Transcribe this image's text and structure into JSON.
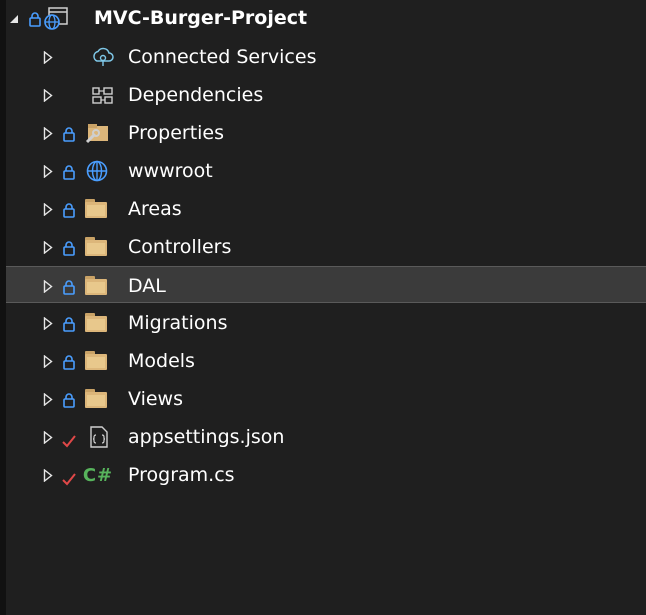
{
  "solution_explorer": {
    "project": {
      "label": "MVC-Burger-Project"
    },
    "items": [
      {
        "label": "Connected Services",
        "icon": "connected-services-icon"
      },
      {
        "label": "Dependencies",
        "icon": "dependencies-icon"
      },
      {
        "label": "Properties",
        "icon": "properties-folder-icon"
      },
      {
        "label": "wwwroot",
        "icon": "globe-icon"
      },
      {
        "label": "Areas",
        "icon": "folder-icon"
      },
      {
        "label": "Controllers",
        "icon": "folder-icon"
      },
      {
        "label": "DAL",
        "icon": "folder-icon",
        "selected": true
      },
      {
        "label": "Migrations",
        "icon": "folder-icon"
      },
      {
        "label": "Models",
        "icon": "folder-icon"
      },
      {
        "label": "Views",
        "icon": "folder-icon"
      },
      {
        "label": "appsettings.json",
        "icon": "json-file-icon"
      },
      {
        "label": "Program.cs",
        "icon": "csharp-file-icon",
        "icon_text": "C#"
      }
    ]
  },
  "colors": {
    "background": "#1f1f1f",
    "selected_row": "#3b3b3b",
    "lock": "#4a9eff",
    "checkmark": "#e04848",
    "folder": "#dcb67a",
    "csharp": "#57b35c"
  }
}
